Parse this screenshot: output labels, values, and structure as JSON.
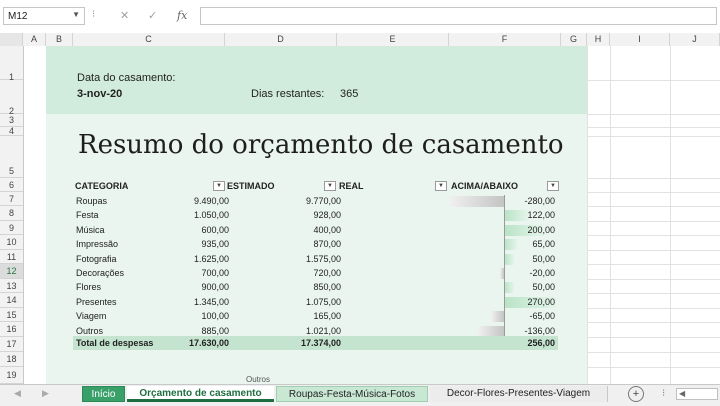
{
  "formula_bar": {
    "name_box": "M12",
    "fx_label": "fx",
    "formula": ""
  },
  "columns": [
    "A",
    "B",
    "C",
    "D",
    "E",
    "F",
    "G",
    "H",
    "I",
    "J"
  ],
  "rows": [
    "1",
    "2",
    "3",
    "4",
    "5",
    "6",
    "7",
    "8",
    "9",
    "10",
    "11",
    "12",
    "13",
    "14",
    "15",
    "16",
    "17",
    "18",
    "19"
  ],
  "sheet": {
    "wedding_date_label": "Data do casamento:",
    "wedding_date": "3-nov-20",
    "days_left_label": "Dias restantes:",
    "days_left": "365",
    "title": "Resumo do orçamento de casamento",
    "headers": {
      "category": "CATEGORIA",
      "estimated": "ESTIMADO",
      "real": "REAL",
      "diff": "ACIMA/ABAIXO"
    },
    "table": [
      {
        "category": "Roupas",
        "estimated": "9.490,00",
        "real": "9.770,00",
        "diff": "-280,00",
        "value": -280
      },
      {
        "category": "Festa",
        "estimated": "1.050,00",
        "real": "928,00",
        "diff": "122,00",
        "value": 122
      },
      {
        "category": "Música",
        "estimated": "600,00",
        "real": "400,00",
        "diff": "200,00",
        "value": 200
      },
      {
        "category": "Impressão",
        "estimated": "935,00",
        "real": "870,00",
        "diff": "65,00",
        "value": 65
      },
      {
        "category": "Fotografia",
        "estimated": "1.625,00",
        "real": "1.575,00",
        "diff": "50,00",
        "value": 50
      },
      {
        "category": "Decorações",
        "estimated": "700,00",
        "real": "720,00",
        "diff": "-20,00",
        "value": -20
      },
      {
        "category": "Flores",
        "estimated": "900,00",
        "real": "850,00",
        "diff": "50,00",
        "value": 50
      },
      {
        "category": "Presentes",
        "estimated": "1.345,00",
        "real": "1.075,00",
        "diff": "270,00",
        "value": 270
      },
      {
        "category": "Viagem",
        "estimated": "100,00",
        "real": "165,00",
        "diff": "-65,00",
        "value": -65
      },
      {
        "category": "Outros",
        "estimated": "885,00",
        "real": "1.021,00",
        "diff": "-136,00",
        "value": -136
      }
    ],
    "totals": {
      "label": "Total de despesas",
      "estimated": "17.630,00",
      "real": "17.374,00",
      "diff": "256,00"
    },
    "partial_label": "Outros"
  },
  "tabs": {
    "items": [
      "Início",
      "Orçamento de casamento",
      "Roupas-Festa-Música-Fotos",
      "Decor-Flores-Presentes-Viagem"
    ],
    "active": 1,
    "add_label": "+"
  },
  "colors": {
    "green_band": "#d1ecdc",
    "green_body": "#e9f5ee",
    "positive_bar": "#b8e3c6",
    "negative_bar": "#c4c4c4",
    "tab_green": "#3aa06a"
  }
}
